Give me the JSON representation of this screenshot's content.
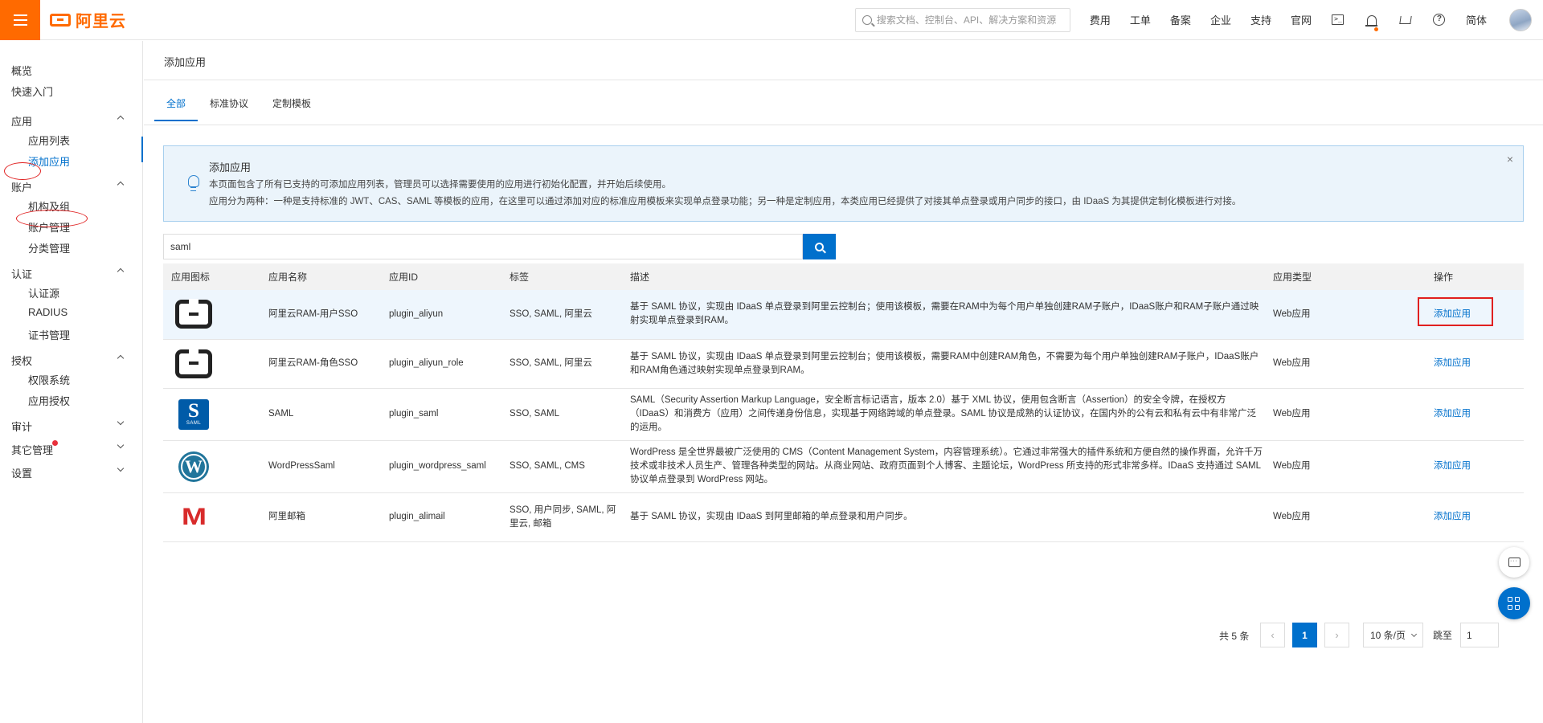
{
  "header": {
    "logo_text": "阿里云",
    "search_placeholder": "搜索文档、控制台、API、解决方案和资源",
    "links": [
      "费用",
      "工单",
      "备案",
      "企业",
      "支持",
      "官网"
    ],
    "lang": "简体",
    "icons": [
      "terminal-icon",
      "bell-icon",
      "cart-icon",
      "help-icon"
    ]
  },
  "sidebar": {
    "overview": "概览",
    "quickstart": "快速入门",
    "groups": {
      "app": "应用",
      "account": "账户",
      "auth": "认证",
      "authorize": "授权",
      "audit": "审计",
      "other": "其它管理",
      "settings": "设置"
    },
    "items": {
      "app_list": "应用列表",
      "add_app": "添加应用",
      "org": "机构及组",
      "account_mgmt": "账户管理",
      "category_mgmt": "分类管理",
      "auth_source": "认证源",
      "radius": "RADIUS",
      "cert_mgmt": "证书管理",
      "perm_system": "权限系统",
      "app_authz": "应用授权"
    }
  },
  "page": {
    "title": "添加应用",
    "tabs": [
      "全部",
      "标准协议",
      "定制模板"
    ],
    "notice": {
      "title": "添加应用",
      "line1": "本页面包含了所有已支持的可添加应用列表，管理员可以选择需要使用的应用进行初始化配置，并开始后续使用。",
      "line2": "应用分为两种：一种是支持标准的 JWT、CAS、SAML 等模板的应用，在这里可以通过添加对应的标准应用模板来实现单点登录功能；另一种是定制应用，本类应用已经提供了对接其单点登录或用户同步的接口，由 IDaaS 为其提供定制化模板进行对接。",
      "close": "×"
    },
    "search_value": "saml"
  },
  "table": {
    "headers": [
      "应用图标",
      "应用名称",
      "应用ID",
      "标签",
      "描述",
      "应用类型",
      "操作"
    ],
    "rows": [
      {
        "icon": "aliyun-logo-icon",
        "name": "阿里云RAM-用户SSO",
        "id": "plugin_aliyun",
        "tags": "SSO, SAML, 阿里云",
        "desc": "基于 SAML 协议，实现由 IDaaS 单点登录到阿里云控制台；使用该模板，需要在RAM中为每个用户单独创建RAM子账户，IDaaS账户和RAM子账户通过映射实现单点登录到RAM。",
        "type": "Web应用",
        "action": "添加应用"
      },
      {
        "icon": "aliyun-logo-icon",
        "name": "阿里云RAM-角色SSO",
        "id": "plugin_aliyun_role",
        "tags": "SSO, SAML, 阿里云",
        "desc": "基于 SAML 协议，实现由 IDaaS 单点登录到阿里云控制台；使用该模板，需要RAM中创建RAM角色，不需要为每个用户单独创建RAM子账户，IDaaS账户和RAM角色通过映射实现单点登录到RAM。",
        "type": "Web应用",
        "action": "添加应用"
      },
      {
        "icon": "saml-logo-icon",
        "name": "SAML",
        "id": "plugin_saml",
        "tags": "SSO, SAML",
        "desc": "SAML（Security Assertion Markup Language，安全断言标记语言，版本 2.0）基于 XML 协议，使用包含断言（Assertion）的安全令牌，在授权方（IDaaS）和消费方（应用）之间传递身份信息，实现基于网络跨域的单点登录。SAML 协议是成熟的认证协议，在国内外的公有云和私有云中有非常广泛的运用。",
        "type": "Web应用",
        "action": "添加应用"
      },
      {
        "icon": "wordpress-logo-icon",
        "name": "WordPressSaml",
        "id": "plugin_wordpress_saml",
        "tags": "SSO, SAML, CMS",
        "desc": "WordPress 是全世界最被广泛使用的 CMS（Content Management System，内容管理系统）。它通过非常强大的插件系统和方便自然的操作界面，允许千万技术或非技术人员生产、管理各种类型的网站。从商业网站、政府页面到个人博客、主题论坛，WordPress 所支持的形式非常多样。IDaaS 支持通过 SAML 协议单点登录到 WordPress 网站。",
        "type": "Web应用",
        "action": "添加应用"
      },
      {
        "icon": "alimail-logo-icon",
        "name": "阿里邮箱",
        "id": "plugin_alimail",
        "tags": "SSO, 用户同步, SAML, 阿里云, 邮箱",
        "desc": "基于 SAML 协议，实现由 IDaaS 到阿里邮箱的单点登录和用户同步。",
        "type": "Web应用",
        "action": "添加应用"
      }
    ]
  },
  "pagination": {
    "total": "共 5 条",
    "prev": "‹",
    "current": "1",
    "next": "›",
    "page_size": "10 条/页",
    "jump_label": "跳至",
    "jump_value": "1"
  },
  "colors": {
    "brand": "#ff6a00",
    "primary": "#0070cc",
    "annotation_red": "#e02020"
  }
}
